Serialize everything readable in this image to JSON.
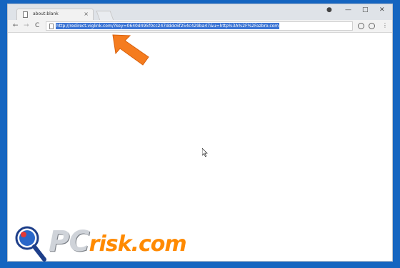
{
  "browser": {
    "tab_title": "about:blank",
    "tab_close": "×",
    "controls": {
      "user": "●",
      "minimize": "—",
      "maximize": "□",
      "close": "✕"
    },
    "nav": {
      "back": "←",
      "forward": "→",
      "reload": "C"
    },
    "url": "http://redirect.viglink.com/?key=0640d495f0cc247dddc6f254c429ba47&u=http%3A%2F%2Fazbro.com",
    "menu": "⋮"
  },
  "watermark": {
    "pc": "PC",
    "risk": "risk.com"
  },
  "colors": {
    "background": "#1565c0",
    "arrow": "#f57c1f",
    "url_highlight": "#3b74d4"
  },
  "icons": [
    "page-icon",
    "back-icon",
    "forward-icon",
    "reload-icon",
    "extension-icon",
    "menu-icon",
    "cursor-icon",
    "pointer-arrow-icon",
    "magnifier-icon"
  ]
}
